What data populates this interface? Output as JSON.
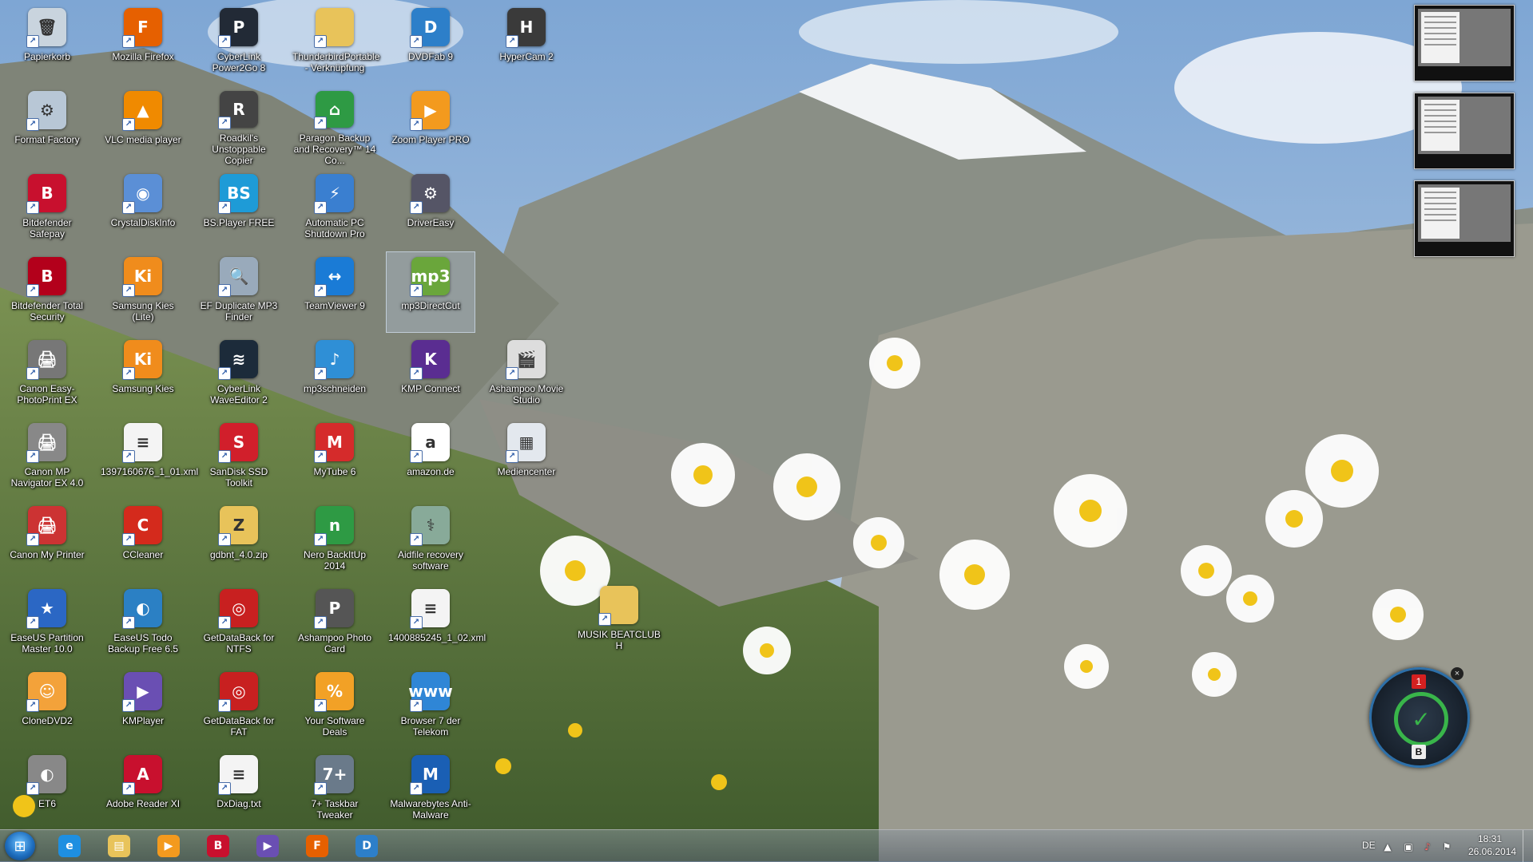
{
  "desktop": {
    "icons": [
      {
        "label": "Papierkorb",
        "icon": "recycle-bin-icon",
        "color": "#c9d4de",
        "glyph": "🗑",
        "selected": false
      },
      {
        "label": "Mozilla Firefox",
        "icon": "firefox-icon",
        "color": "#e66000",
        "glyph": "F",
        "selected": false
      },
      {
        "label": "CyberLink Power2Go 8",
        "icon": "power2go-icon",
        "color": "#222a36",
        "glyph": "P",
        "selected": false
      },
      {
        "label": "ThunderbirdPortable - Verknüpfung",
        "icon": "folder-icon",
        "color": "#e8c35a",
        "glyph": "",
        "selected": false
      },
      {
        "label": "DVDFab 9",
        "icon": "dvdfab-icon",
        "color": "#2d7fc9",
        "glyph": "D",
        "selected": false
      },
      {
        "label": "HyperCam 2",
        "icon": "hypercam-icon",
        "color": "#3a3a3a",
        "glyph": "H",
        "selected": false
      },
      {
        "label": "Format Factory",
        "icon": "format-factory-icon",
        "color": "#b8c7d6",
        "glyph": "⚙",
        "selected": false
      },
      {
        "label": "VLC media player",
        "icon": "vlc-icon",
        "color": "#f08a00",
        "glyph": "▲",
        "selected": false
      },
      {
        "label": "Roadkil's Unstoppable Copier",
        "icon": "roadkil-icon",
        "color": "#444",
        "glyph": "R",
        "selected": false
      },
      {
        "label": "Paragon Backup and Recovery™ 14 Co...",
        "icon": "paragon-icon",
        "color": "#2e9a44",
        "glyph": "⌂",
        "selected": false
      },
      {
        "label": "Zoom Player PRO",
        "icon": "zoom-player-icon",
        "color": "#f39a1e",
        "glyph": "▶",
        "selected": false
      },
      {
        "label": "Bitdefender Safepay",
        "icon": "bitdefender-safepay-icon",
        "color": "#c8102e",
        "glyph": "B",
        "selected": false
      },
      {
        "label": "CrystalDiskInfo",
        "icon": "crystaldiskinfo-icon",
        "color": "#5b8fd6",
        "glyph": "◉",
        "selected": false
      },
      {
        "label": "BS.Player FREE",
        "icon": "bsplayer-icon",
        "color": "#1e9bd7",
        "glyph": "BS",
        "selected": false
      },
      {
        "label": "Automatic PC Shutdown Pro",
        "icon": "shutdown-icon",
        "color": "#3a7fd0",
        "glyph": "⚡",
        "selected": false
      },
      {
        "label": "DriverEasy",
        "icon": "drivereasy-icon",
        "color": "#556",
        "glyph": "⚙",
        "selected": false
      },
      {
        "label": "Bitdefender Total Security",
        "icon": "bitdefender-icon",
        "color": "#b3001b",
        "glyph": "B",
        "selected": false
      },
      {
        "label": "Samsung Kies (Lite)",
        "icon": "samsung-kies-lite-icon",
        "color": "#f08c1c",
        "glyph": "Ki",
        "selected": false
      },
      {
        "label": "EF Duplicate MP3 Finder",
        "icon": "duplicate-finder-icon",
        "color": "#9ab",
        "glyph": "🔍",
        "selected": false
      },
      {
        "label": "TeamViewer 9",
        "icon": "teamviewer-icon",
        "color": "#1a7bd6",
        "glyph": "↔",
        "selected": false
      },
      {
        "label": "mp3DirectCut",
        "icon": "mp3directcut-icon",
        "color": "#6aa63b",
        "glyph": "mp3",
        "selected": true
      },
      {
        "label": "Canon Easy-PhotoPrint EX",
        "icon": "canon-printer-icon",
        "color": "#777",
        "glyph": "🖨",
        "selected": false
      },
      {
        "label": "Samsung Kies",
        "icon": "samsung-kies-icon",
        "color": "#f08c1c",
        "glyph": "Ki",
        "selected": false
      },
      {
        "label": "CyberLink WaveEditor 2",
        "icon": "waveeditor-icon",
        "color": "#1c2b3a",
        "glyph": "≋",
        "selected": false
      },
      {
        "label": "mp3schneiden",
        "icon": "mp3schneiden-icon",
        "color": "#2f8fd6",
        "glyph": "♪",
        "selected": false
      },
      {
        "label": "KMP Connect",
        "icon": "kmp-connect-icon",
        "color": "#5a2d91",
        "glyph": "K",
        "selected": false
      },
      {
        "label": "Ashampoo Movie Studio",
        "icon": "ashampoo-movie-icon",
        "color": "#ddd",
        "glyph": "🎬",
        "selected": false
      },
      {
        "label": "Canon MP Navigator EX 4.0",
        "icon": "canon-navigator-icon",
        "color": "#888",
        "glyph": "🖨",
        "selected": false
      },
      {
        "label": "1397160676_1_01.xml",
        "icon": "xml-file-icon",
        "color": "#f4f4f4",
        "glyph": "≡",
        "selected": false
      },
      {
        "label": "SanDisk SSD Toolkit",
        "icon": "sandisk-icon",
        "color": "#d11f2b",
        "glyph": "S",
        "selected": false
      },
      {
        "label": "MyTube 6",
        "icon": "mytube-icon",
        "color": "#d52b2b",
        "glyph": "M",
        "selected": false
      },
      {
        "label": "amazon.de",
        "icon": "amazon-icon",
        "color": "#ffffff",
        "glyph": "a",
        "selected": false
      },
      {
        "label": "Mediencenter",
        "icon": "mediencenter-icon",
        "color": "#e3e8ee",
        "glyph": "▦",
        "selected": false
      },
      {
        "label": "Canon My Printer",
        "icon": "canon-my-printer-icon",
        "color": "#c33",
        "glyph": "🖨",
        "selected": false
      },
      {
        "label": "CCleaner",
        "icon": "ccleaner-icon",
        "color": "#d42a1c",
        "glyph": "C",
        "selected": false
      },
      {
        "label": "gdbnt_4.0.zip",
        "icon": "zip-folder-icon",
        "color": "#e8c35a",
        "glyph": "Z",
        "selected": false
      },
      {
        "label": "Nero BackItUp 2014",
        "icon": "nero-icon",
        "color": "#2e9a44",
        "glyph": "n",
        "selected": false
      },
      {
        "label": "Aidfile recovery software",
        "icon": "aidfile-icon",
        "color": "#8a9",
        "glyph": "⚕",
        "selected": false
      },
      {
        "label": "EaseUS Partition Master 10.0",
        "icon": "easeus-partition-icon",
        "color": "#2b67c4",
        "glyph": "★",
        "selected": false
      },
      {
        "label": "EaseUS Todo Backup Free 6.5",
        "icon": "easeus-todo-icon",
        "color": "#2b80c4",
        "glyph": "◐",
        "selected": false
      },
      {
        "label": "GetDataBack for NTFS",
        "icon": "getdataback-ntfs-icon",
        "color": "#c82020",
        "glyph": "◎",
        "selected": false
      },
      {
        "label": "Ashampoo Photo Card",
        "icon": "ashampoo-photo-icon",
        "color": "#555",
        "glyph": "P",
        "selected": false
      },
      {
        "label": "1400885245_1_02.xml",
        "icon": "xml-file-icon",
        "color": "#f4f4f4",
        "glyph": "≡",
        "selected": false
      },
      {
        "label": "MUSIK BEATCLUB H",
        "icon": "folder-icon",
        "color": "#e8c35a",
        "glyph": "",
        "selected": false
      },
      {
        "label": "CloneDVD2",
        "icon": "clonedvd-icon",
        "color": "#f3a23a",
        "glyph": "☺",
        "selected": false
      },
      {
        "label": "KMPlayer",
        "icon": "kmplayer-icon",
        "color": "#6a4fb3",
        "glyph": "▶",
        "selected": false
      },
      {
        "label": "GetDataBack for FAT",
        "icon": "getdataback-fat-icon",
        "color": "#c82020",
        "glyph": "◎",
        "selected": false
      },
      {
        "label": "Your Software Deals",
        "icon": "software-deals-icon",
        "color": "#f2a126",
        "glyph": "%",
        "selected": false
      },
      {
        "label": "Browser 7 der Telekom",
        "icon": "telekom-browser-icon",
        "color": "#2f86d6",
        "glyph": "www",
        "selected": false
      },
      {
        "label": "ET6",
        "icon": "et6-icon",
        "color": "#888",
        "glyph": "◐",
        "selected": false
      },
      {
        "label": "Adobe Reader XI",
        "icon": "adobe-reader-icon",
        "color": "#c8102e",
        "glyph": "A",
        "selected": false
      },
      {
        "label": "DxDiag.txt",
        "icon": "text-file-icon",
        "color": "#f4f4f4",
        "glyph": "≡",
        "selected": false
      },
      {
        "label": "7+ Taskbar Tweaker",
        "icon": "taskbar-tweaker-icon",
        "color": "#6a7a8a",
        "glyph": "7+",
        "selected": false
      },
      {
        "label": "Malwarebytes Anti-Malware",
        "icon": "malwarebytes-icon",
        "color": "#1a5fb4",
        "glyph": "M",
        "selected": false
      }
    ],
    "tooltip_text": "mp3DirectCut"
  },
  "gadget": {
    "badge": "1",
    "letter": "B",
    "check": "✓",
    "close": "×"
  },
  "taskbar": {
    "start_glyph": "⊞",
    "apps": [
      {
        "name": "internet-explorer",
        "icon": "internet-explorer-icon",
        "color": "#1e8fe1",
        "glyph": "e"
      },
      {
        "name": "explorer",
        "icon": "file-explorer-icon",
        "color": "#e8c35a",
        "glyph": "▤"
      },
      {
        "name": "zoom-player",
        "icon": "zoom-player-icon",
        "color": "#f39a1e",
        "glyph": "▶"
      },
      {
        "name": "bitdefender-safepay",
        "icon": "bitdefender-safepay-icon",
        "color": "#c8102e",
        "glyph": "B"
      },
      {
        "name": "kmplayer",
        "icon": "kmplayer-icon",
        "color": "#6a4fb3",
        "glyph": "▶"
      },
      {
        "name": "firefox",
        "icon": "firefox-icon",
        "color": "#e66000",
        "glyph": "F"
      },
      {
        "name": "dvdfab",
        "icon": "dvdfab-icon",
        "color": "#2d7fc9",
        "glyph": "D"
      }
    ],
    "language": "DE",
    "time": "18:31",
    "date": "26.06.2014"
  }
}
